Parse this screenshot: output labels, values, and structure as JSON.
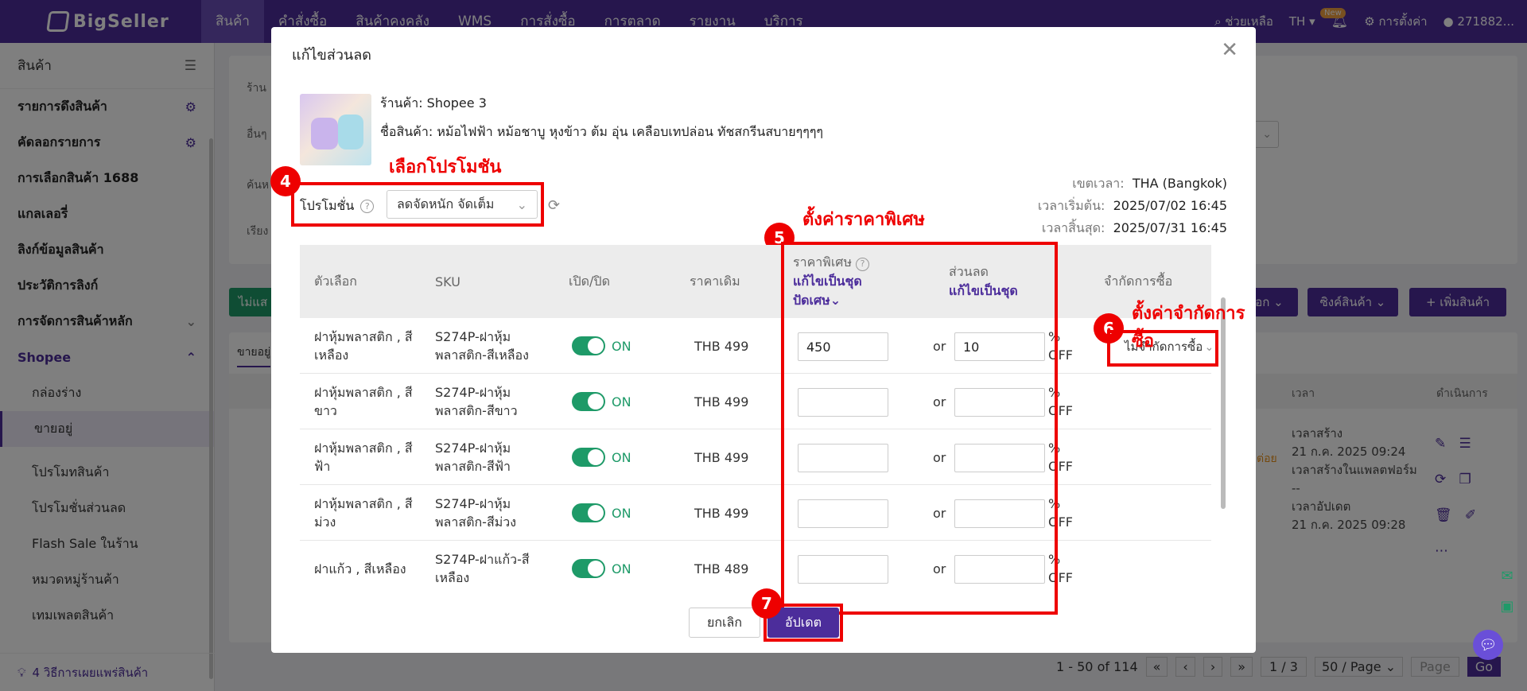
{
  "topbar": {
    "logo": "BigSeller",
    "nav": [
      "สินค้า",
      "คำสั่งซื้อ",
      "สินค้าคงคลัง",
      "WMS",
      "การสั่งซื้อ",
      "การตลาด",
      "รายงาน",
      "บริการ"
    ],
    "help": "ช่วยเหลือ",
    "lang": "TH",
    "new_badge": "New",
    "settings": "การตั้งค่า",
    "user": "271882..."
  },
  "sidebar": {
    "title": "สินค้า",
    "items": [
      "รายการดึงสินค้า",
      "คัดลอกรายการ",
      "การเลือกสินค้า 1688",
      "แกลเลอรี่",
      "ลิงก์ข้อมูลสินค้า",
      "ประวัติการลิงก์",
      "การจัดการสินค้าหลัก"
    ],
    "parent": "Shopee",
    "subs": [
      "กล่องร่าง",
      "ขายอยู่",
      "โปรโมทสินค้า",
      "โปรโมชั่นส่วนลด",
      "Flash Sale ในร้าน",
      "หมวดหมู่ร้านค้า",
      "เทมเพลตสินค้า"
    ],
    "footer": "4 วิธีการเผยแพร่สินค้า"
  },
  "background": {
    "hint1": "ร้าน",
    "hint2": "อื่นๆ",
    "hint3": "ค้นห",
    "hint4": "เรียง",
    "btn_left": "ไม่แส",
    "tab": "ขายอยู่",
    "btn_right_partial": "อก",
    "sync_btn": "ซิงค์สินค้า",
    "add_btn": "+ เพิ่มสินค้า",
    "col_time": "เวลา",
    "col_action": "ดำเนินการ",
    "t1": "เวลาสร้าง",
    "t1v": "21 ก.ค. 2025 09:24",
    "t2": "เวลาสร้างในแพลตฟอร์ม",
    "t2v": "--",
    "t3": "เวลาอัปเดต",
    "t3v": "21 ก.ค. 2025 09:28",
    "orange": "ต่อย",
    "pagination": "1 - 50 of 114",
    "page": "1 / 3",
    "per_page": "50 / Page",
    "page_input": "Page",
    "go": "Go"
  },
  "modal": {
    "title": "แก้ไขส่วนลด",
    "shop": "ร้านค้า: Shopee 3",
    "product": "ชื่อสินค้า: หม้อไฟฟ้า หม้อชาบู หุงข้าว ต้ม อุ่น เคลือบเทปล่อน ทัชสกรีนสบายๆๆๆๆ",
    "promo_label": "โปรโมชั่น",
    "promo_value": "ลดจัดหนัก จัดเต็ม",
    "tz_label": "เขตเวลา:",
    "tz_value": "THA (Bangkok)",
    "start_label": "เวลาเริ่มต้น:",
    "start_value": "2025/07/02 16:45",
    "end_label": "เวลาสิ้นสุด:",
    "end_value": "2025/07/31 16:45",
    "headers": {
      "option": "ตัวเลือก",
      "sku": "SKU",
      "toggle": "เปิด/ปิด",
      "orig": "ราคาเดิม",
      "special": "ราคาพิเศษ",
      "special_bulk": "แก้ไขเป็นชุด",
      "special_round": "ปัดเศษ",
      "discount": "ส่วนลด",
      "discount_bulk": "แก้ไขเป็นชุด",
      "limit": "จำกัดการซื้อ"
    },
    "rows": [
      {
        "option": "ฝาหุ้มพลาสติก , สีเหลือง",
        "sku": "S274P-ฝาหุ้มพลาสติก-สีเหลือง",
        "toggle": "ON",
        "orig": "THB 499",
        "special": "450",
        "or": "or",
        "discount": "10",
        "pct": "% OFF",
        "limit": "ไม่จำกัดการซื้อ"
      },
      {
        "option": "ฝาหุ้มพลาสติก , สีขาว",
        "sku": "S274P-ฝาหุ้มพลาสติก-สีขาว",
        "toggle": "ON",
        "orig": "THB 499",
        "special": "",
        "or": "or",
        "discount": "",
        "pct": "% OFF",
        "limit": ""
      },
      {
        "option": "ฝาหุ้มพลาสติก , สีฟ้า",
        "sku": "S274P-ฝาหุ้มพลาสติก-สีฟ้า",
        "toggle": "ON",
        "orig": "THB 499",
        "special": "",
        "or": "or",
        "discount": "",
        "pct": "% OFF",
        "limit": ""
      },
      {
        "option": "ฝาหุ้มพลาสติก , สีม่วง",
        "sku": "S274P-ฝาหุ้มพลาสติก-สีม่วง",
        "toggle": "ON",
        "orig": "THB 499",
        "special": "",
        "or": "or",
        "discount": "",
        "pct": "% OFF",
        "limit": ""
      },
      {
        "option": "ฝาแก้ว , สีเหลือง",
        "sku": "S274P-ฝาแก้ว-สีเหลือง",
        "toggle": "ON",
        "orig": "THB 489",
        "special": "",
        "or": "or",
        "discount": "",
        "pct": "% OFF",
        "limit": ""
      }
    ],
    "cancel": "ยกเลิก",
    "update": "อัปเดต"
  },
  "annotations": {
    "a4": "เลือกโปรโมชัน",
    "n4": "4",
    "a5": "ตั้งค่าราคาพิเศษ",
    "n5": "5",
    "a6": "ตั้งค่าจำกัดการซื้อ",
    "n6": "6",
    "n7": "7"
  },
  "colors": {
    "brand": "#4c2d9b",
    "on": "#1e9a68",
    "annotation": "#e00000"
  }
}
